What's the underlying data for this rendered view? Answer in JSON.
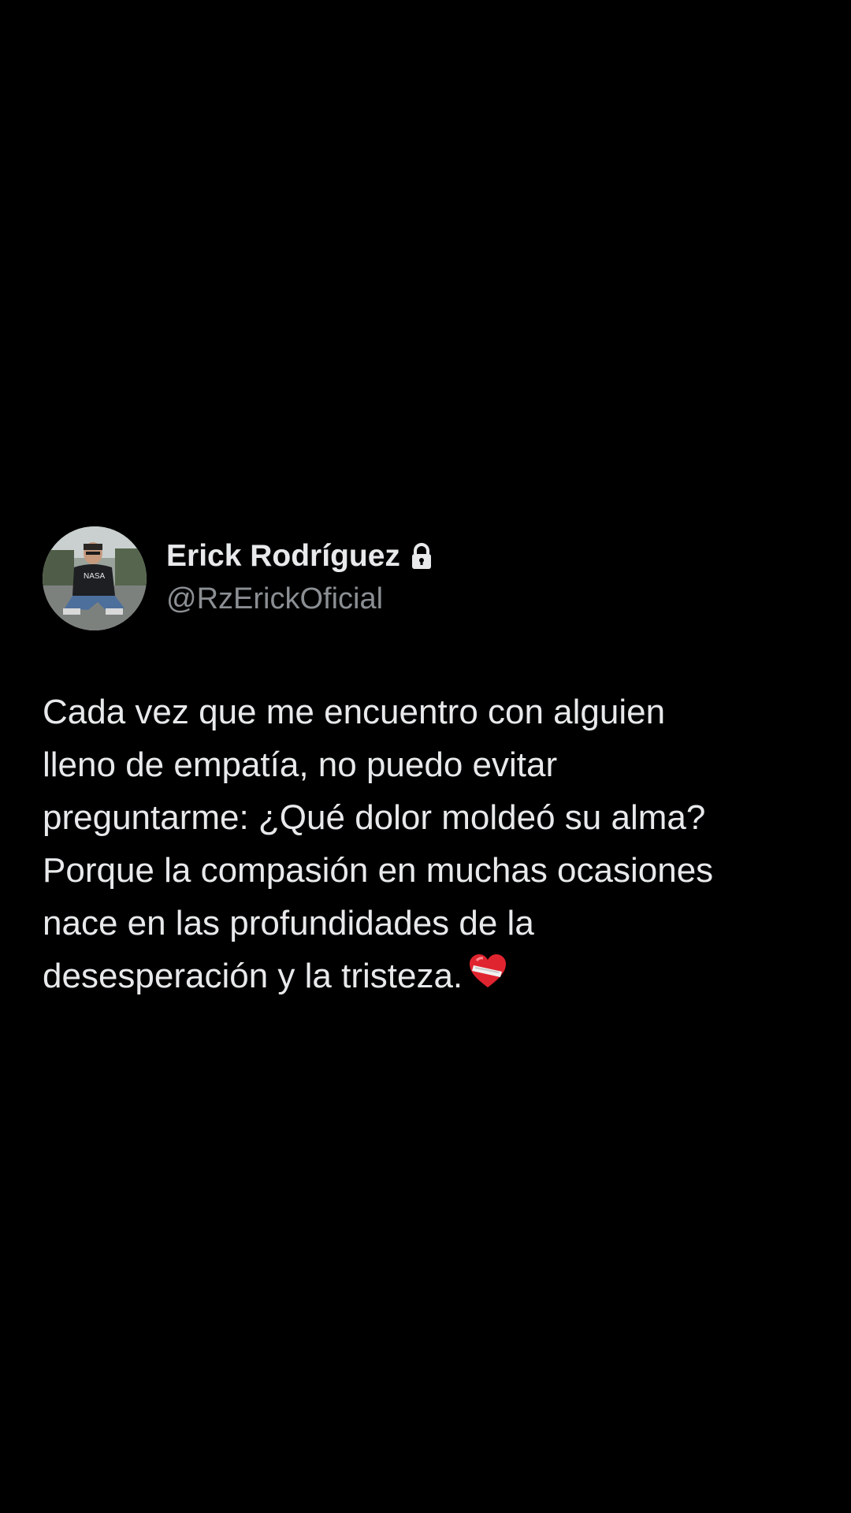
{
  "author": {
    "display_name": "Erick Rodríguez",
    "handle": "@RzErickOficial",
    "verified_icon": "lock-icon",
    "avatar": "profile-photo"
  },
  "post": {
    "text": "Cada vez que me encuentro con alguien\nlleno de empatía, no puedo evitar\npreguntarme: ¿Qué dolor moldeó su alma?\nPorque la compasión en muchas ocasiones\nnace en las profundidades de la\ndesesperación y la tristeza.",
    "trailing_emoji": "mending-heart-icon"
  },
  "colors": {
    "background": "#000000",
    "primary_text": "#e7e9ea",
    "secondary_text": "#8b8f93",
    "heart_red": "#e0242f"
  }
}
